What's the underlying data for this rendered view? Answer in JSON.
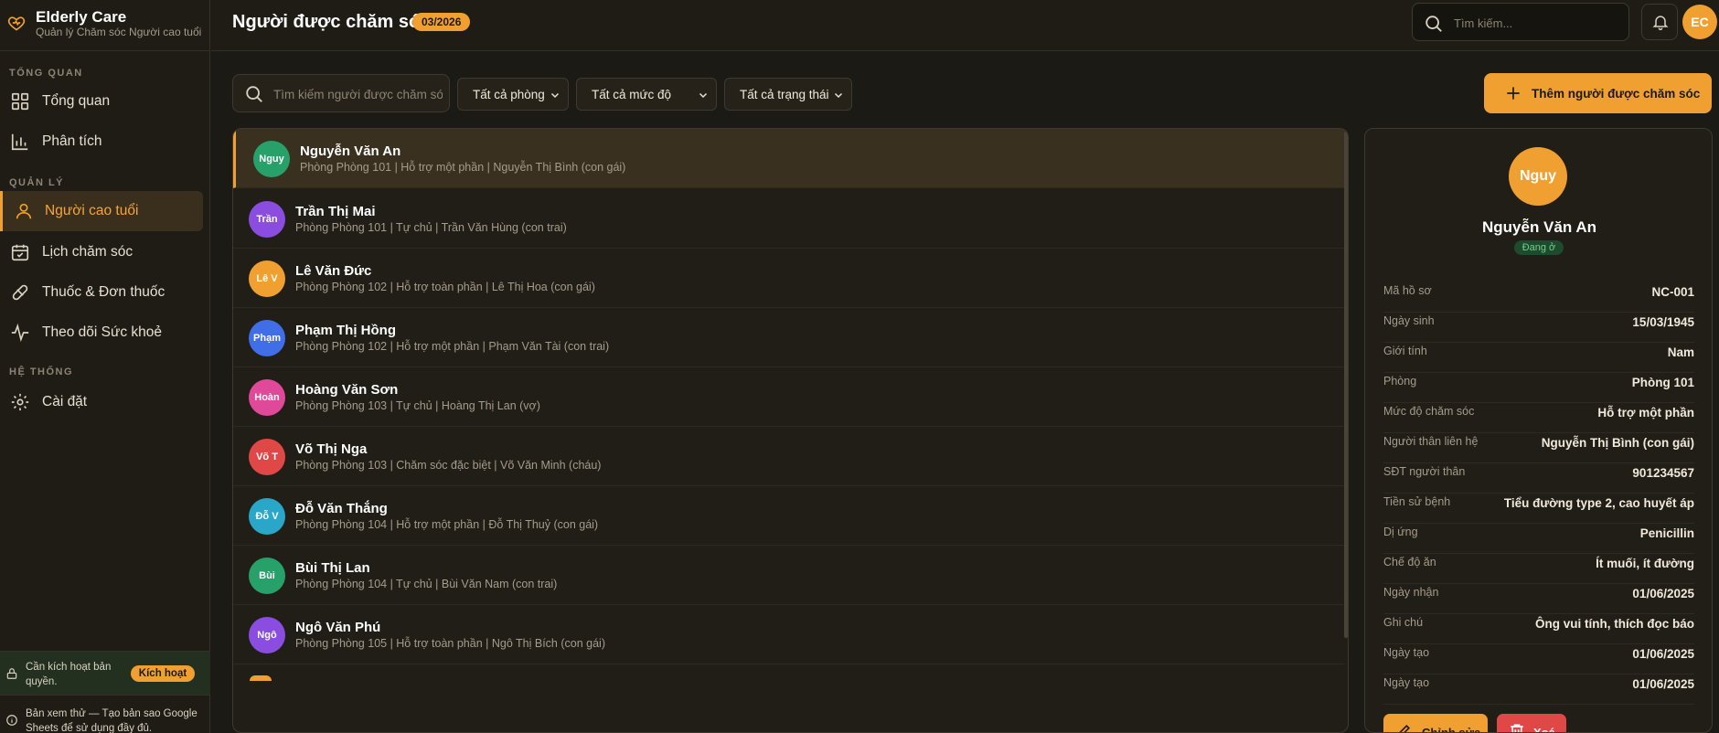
{
  "brand": {
    "name": "Elderly Care",
    "subtitle": "Quản lý Chăm sóc Người cao tuổi"
  },
  "sidebar": {
    "sections": [
      "TỔNG QUAN",
      "QUẢN LÝ",
      "HỆ THỐNG"
    ],
    "items": [
      {
        "label": "Tổng quan",
        "icon": "dashboard-icon"
      },
      {
        "label": "Phân tích",
        "icon": "bar-chart-icon"
      },
      {
        "label": "Người cao tuổi",
        "icon": "user-icon",
        "active": true
      },
      {
        "label": "Lịch chăm sóc",
        "icon": "calendar-icon"
      },
      {
        "label": "Thuốc & Đơn thuốc",
        "icon": "pill-icon"
      },
      {
        "label": "Theo dõi Sức khoẻ",
        "icon": "activity-icon"
      },
      {
        "label": "Cài đặt",
        "icon": "gear-icon"
      }
    ],
    "license": {
      "text": "Cần kích hoạt bản quyền.",
      "button": "Kích hoạt"
    },
    "trial": {
      "text": "Bản xem thử — Tạo bản sao Google Sheets để sử dụng đầy đủ."
    }
  },
  "header": {
    "title": "Người được chăm sóc",
    "badge": "03/2026",
    "search_placeholder": "Tìm kiếm...",
    "user_initials": "EC"
  },
  "toolbar": {
    "search_placeholder": "Tìm kiếm người được chăm sóc...",
    "filters": [
      "Tất cả phòng",
      "Tất cả mức độ",
      "Tất cả trạng thái"
    ],
    "add_label": "Thêm người được chăm sóc"
  },
  "residents": [
    {
      "initials": "Nguy",
      "name": "Nguyễn Văn An",
      "meta": "Phòng Phòng 101 | Hỗ trợ một phần | Nguyễn Thị Bình (con gái)",
      "color": "#27a06a"
    },
    {
      "initials": "Trần",
      "name": "Trần Thị Mai",
      "meta": "Phòng Phòng 101 | Tự chủ | Trần Văn Hùng (con trai)",
      "color": "#8a4de0"
    },
    {
      "initials": "Lê V",
      "name": "Lê Văn Đức",
      "meta": "Phòng Phòng 102 | Hỗ trợ toàn phần | Lê Thị Hoa (con gái)",
      "color": "#f0a030"
    },
    {
      "initials": "Phạm",
      "name": "Phạm Thị Hồng",
      "meta": "Phòng Phòng 102 | Hỗ trợ một phần | Phạm Văn Tài (con trai)",
      "color": "#3f6ee8"
    },
    {
      "initials": "Hoàn",
      "name": "Hoàng Văn Sơn",
      "meta": "Phòng Phòng 103 | Tự chủ | Hoàng Thị Lan (vợ)",
      "color": "#e0489a"
    },
    {
      "initials": "Võ T",
      "name": "Võ Thị Nga",
      "meta": "Phòng Phòng 103 | Chăm sóc đặc biệt | Võ Văn Minh (cháu)",
      "color": "#e04848"
    },
    {
      "initials": "Đỗ V",
      "name": "Đỗ Văn Thắng",
      "meta": "Phòng Phòng 104 | Hỗ trợ một phần | Đỗ Thị Thuỷ (con gái)",
      "color": "#2aa6c8"
    },
    {
      "initials": "Bùi",
      "name": "Bùi Thị Lan",
      "meta": "Phòng Phòng 104 | Tự chủ | Bùi Văn Nam (con trai)",
      "color": "#27a06a"
    },
    {
      "initials": "Ngô",
      "name": "Ngô Văn Phú",
      "meta": "Phòng Phòng 105 | Hỗ trợ toàn phần | Ngô Thị Bích (con gái)",
      "color": "#8a4de0"
    }
  ],
  "detail": {
    "initials": "Nguy",
    "name": "Nguyễn Văn An",
    "status": "Đang ở",
    "fields": [
      {
        "k": "Mã hồ sơ",
        "v": "NC-001"
      },
      {
        "k": "Ngày sinh",
        "v": "15/03/1945"
      },
      {
        "k": "Giới tính",
        "v": "Nam"
      },
      {
        "k": "Phòng",
        "v": "Phòng 101"
      },
      {
        "k": "Mức độ chăm sóc",
        "v": "Hỗ trợ một phần"
      },
      {
        "k": "Người thân liên hệ",
        "v": "Nguyễn Thị Bình (con gái)"
      },
      {
        "k": "SĐT người thân",
        "v": "901234567"
      },
      {
        "k": "Tiền sử bệnh",
        "v": "Tiểu đường type 2, cao huyết áp"
      },
      {
        "k": "Dị ứng",
        "v": "Penicillin"
      },
      {
        "k": "Chế độ ăn",
        "v": "Ít muối, ít đường"
      },
      {
        "k": "Ngày nhận",
        "v": "01/06/2025"
      },
      {
        "k": "Ghi chú",
        "v": "Ông vui tính, thích đọc báo"
      },
      {
        "k": "Ngày tạo",
        "v": "01/06/2025"
      },
      {
        "k": "Ngày tạo",
        "v": "01/06/2025"
      }
    ],
    "edit_label": "Chỉnh sửa",
    "delete_label": "Xoá"
  },
  "colors": {
    "accent": "#f0a030",
    "danger": "#e04848",
    "bg": "#1c1a15"
  }
}
